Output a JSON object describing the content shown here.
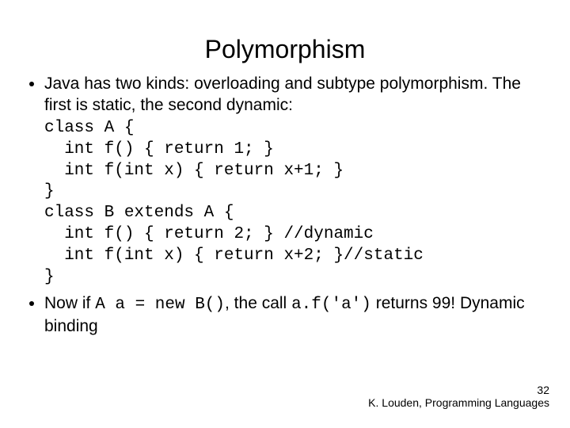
{
  "title": "Polymorphism",
  "bullet1_text": "Java has two kinds: overloading and subtype polymorphism. The first is static, the second dynamic:",
  "code": "class A {\n  int f() { return 1; }\n  int f(int x) { return x+1; }\n}\nclass B extends A {\n  int f() { return 2; } //dynamic\n  int f(int x) { return x+2; }//static\n}",
  "bullet2_prefix": "Now if ",
  "bullet2_code1": "A a = new B()",
  "bullet2_mid": ", the call ",
  "bullet2_code2": "a.f('a')",
  "bullet2_suffix": " returns 99! Dynamic binding",
  "page_number": "32",
  "footer_author": "K. Louden, Programming Languages"
}
